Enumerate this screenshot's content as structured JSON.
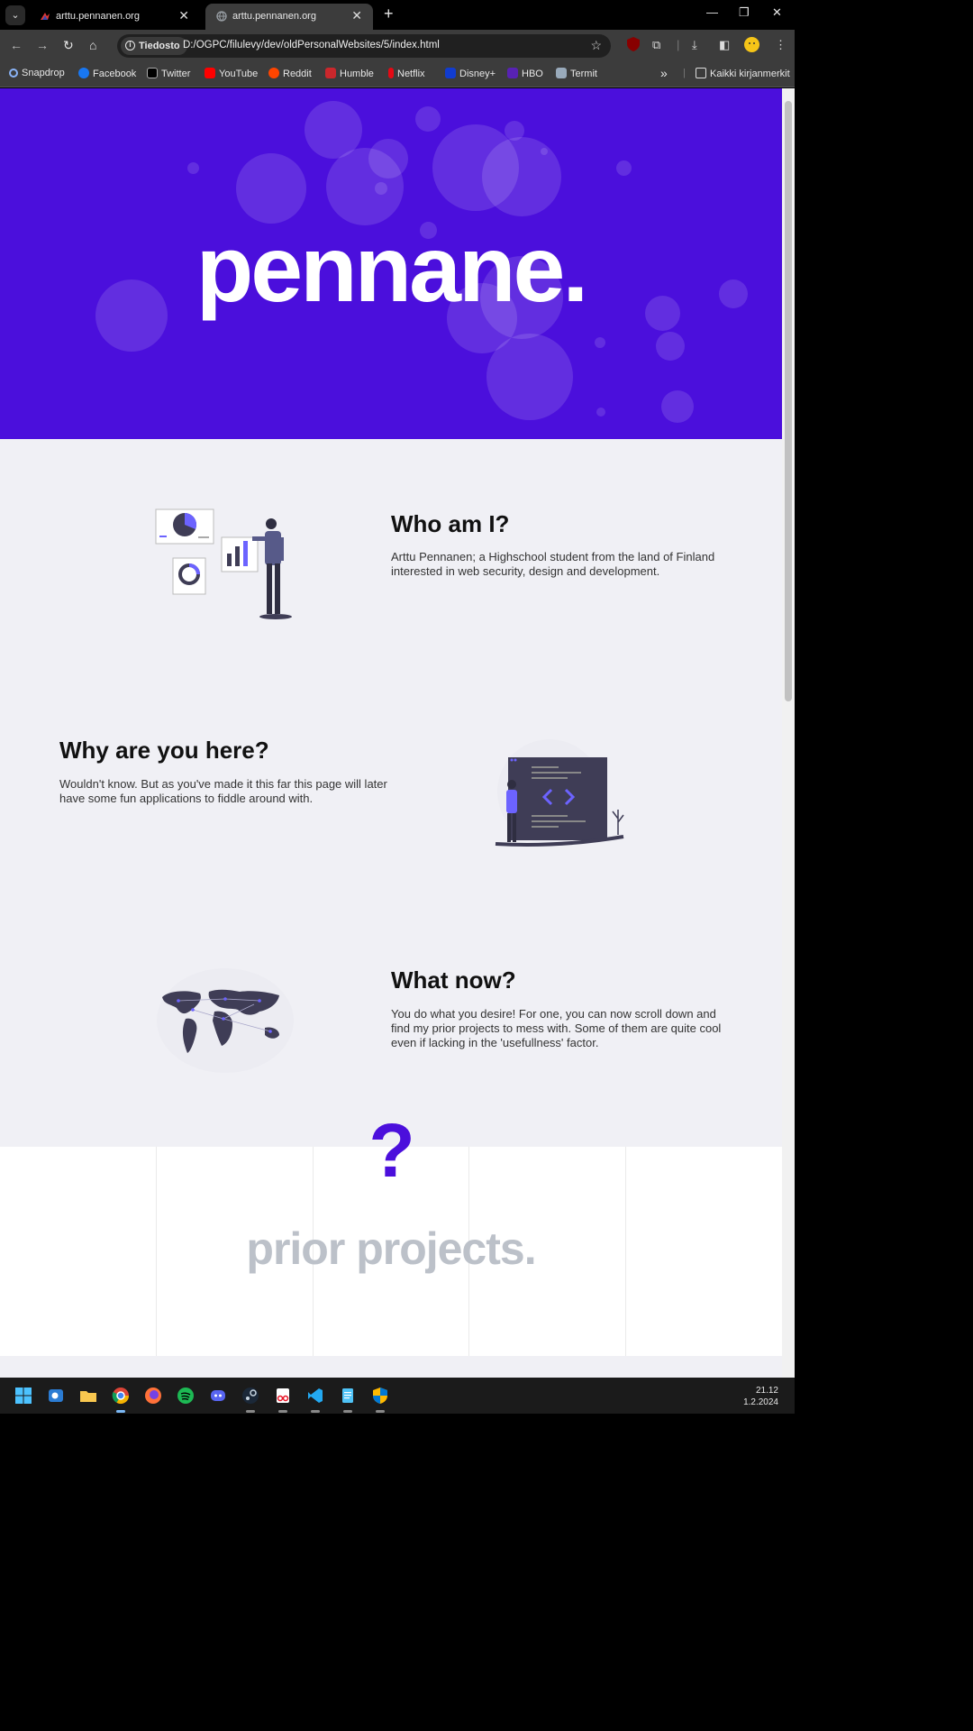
{
  "browser": {
    "tabs": [
      {
        "title": "arttu.pennanen.org",
        "active": false
      },
      {
        "title": "arttu.pennanen.org",
        "active": true
      }
    ],
    "security_chip": "Tiedosto",
    "url": "D:/OGPC/filulevy/dev/oldPersonalWebsites/5/index.html",
    "bookmarks": [
      "Snapdrop",
      "Facebook",
      "Twitter",
      "YouTube",
      "Reddit",
      "Humble",
      "Netflix",
      "Disney+",
      "HBO",
      "Termit"
    ],
    "bookmarks_overflow": "»",
    "all_bookmarks": "Kaikki kirjanmerkit"
  },
  "page": {
    "hero_title": "pennane.",
    "sections": [
      {
        "title": "Who am I?",
        "text": "Arttu Pennanen; a Highschool student from the land of Finland interested in web security, design and development."
      },
      {
        "title": "Why are you here?",
        "text": "Wouldn't know. But as you've made it this far this page will later have some fun applications to fiddle around with."
      },
      {
        "title": "What now?",
        "text": "You do what you desire! For one, you can now scroll down and find my prior projects to mess with. Some of them are quite cool even if lacking in the 'usefullness' factor."
      }
    ],
    "question_mark": "?",
    "projects_title": "prior projects."
  },
  "taskbar": {
    "time": "21.12",
    "date": "1.2.2024"
  },
  "colors": {
    "accent": "#4b0fdc",
    "page_bg": "#f0f0f5",
    "projects_title": "#bcc1c9"
  }
}
